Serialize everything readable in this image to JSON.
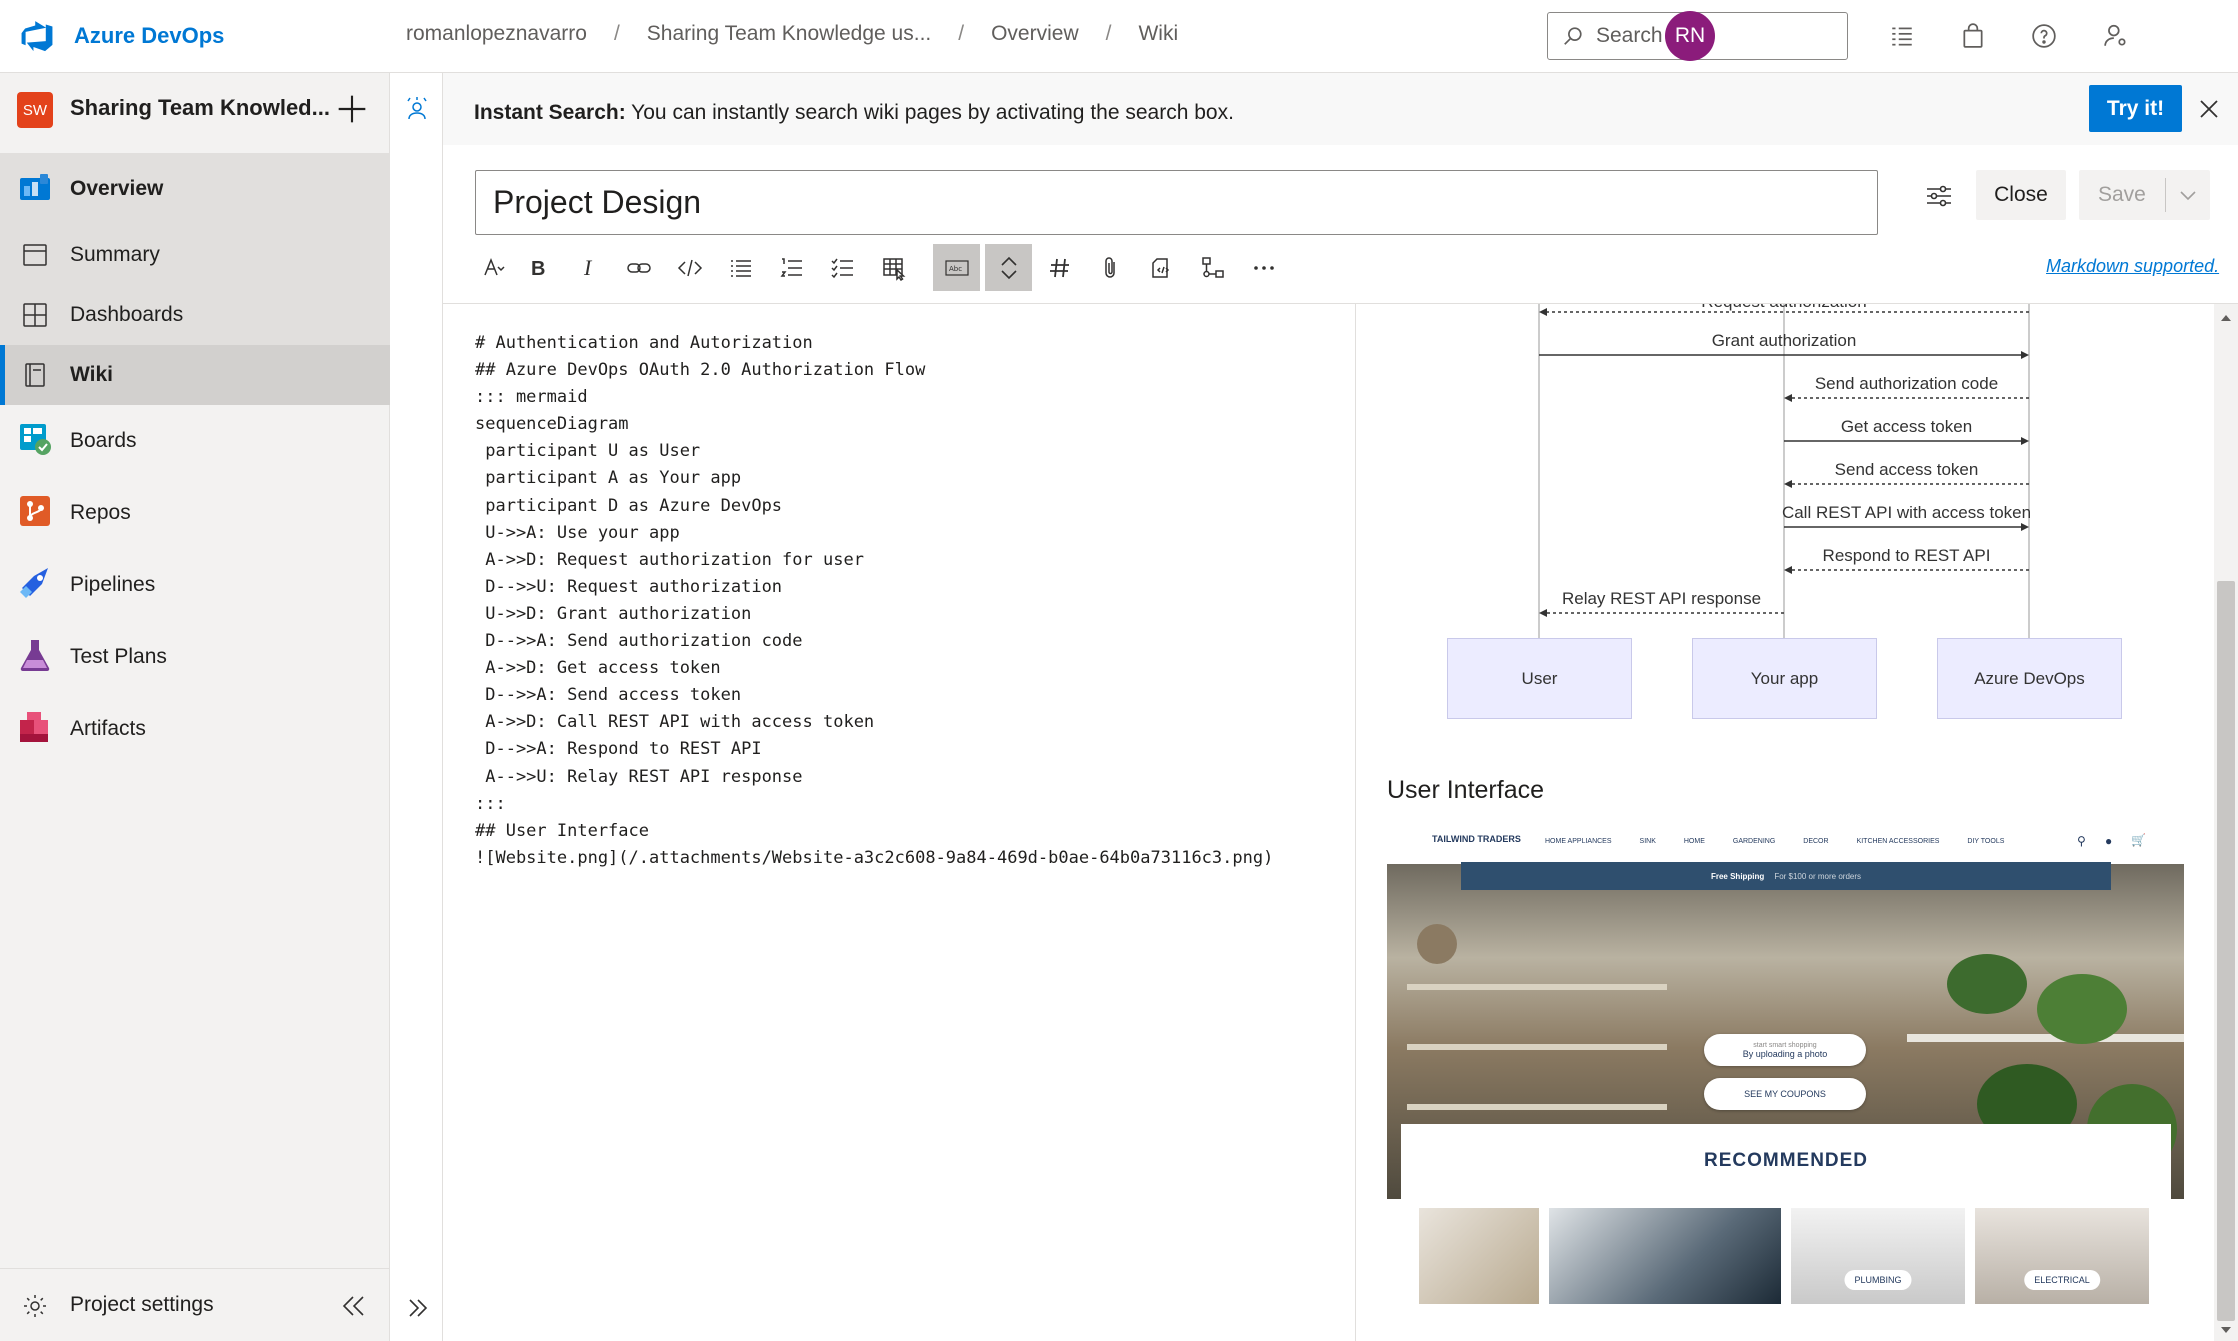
{
  "app": {
    "brand": "Azure DevOps",
    "breadcrumb": [
      "romanlopeznavarro",
      "Sharing Team Knowledge us...",
      "Overview",
      "Wiki"
    ],
    "search_placeholder": "Search",
    "avatar_initials": "RN",
    "brand_color": "#0078d4"
  },
  "sidebar": {
    "project_badge": "SW",
    "project_name": "Sharing Team Knowled...",
    "items": [
      {
        "label": "Overview",
        "icon": "overview-icon"
      },
      {
        "label": "Summary",
        "icon": "summary-icon"
      },
      {
        "label": "Dashboards",
        "icon": "dashboards-icon"
      },
      {
        "label": "Wiki",
        "icon": "wiki-icon"
      },
      {
        "label": "Boards",
        "icon": "boards-icon"
      },
      {
        "label": "Repos",
        "icon": "repos-icon"
      },
      {
        "label": "Pipelines",
        "icon": "pipelines-icon"
      },
      {
        "label": "Test Plans",
        "icon": "test-plans-icon"
      },
      {
        "label": "Artifacts",
        "icon": "artifacts-icon"
      }
    ],
    "footer_label": "Project settings"
  },
  "banner": {
    "bold": "Instant Search:",
    "text": " You can instantly search wiki pages by activating the search box.",
    "button": "Try it!"
  },
  "editor": {
    "title": "Project Design",
    "close_label": "Close",
    "save_label": "Save",
    "markdown_link": "Markdown supported.",
    "code": "# Authentication and Autorization\n## Azure DevOps OAuth 2.0 Authorization Flow\n::: mermaid\nsequenceDiagram\n participant U as User\n participant A as Your app\n participant D as Azure DevOps\n U->>A: Use your app\n A->>D: Request authorization for user\n D-->>U: Request authorization\n U->>D: Grant authorization\n D-->>A: Send authorization code\n A->>D: Get access token\n D-->>A: Send access token\n A->>D: Call REST API with access token\n D-->>A: Respond to REST API\n A-->>U: Relay REST API response\n:::\n## User Interface\n![Website.png](/.attachments/Website-a3c2c608-9a84-469d-b0ae-64b0a73116c3.png)"
  },
  "preview": {
    "partial_message": "Request authorization",
    "messages": [
      "Grant authorization",
      "Send authorization code",
      "Get access token",
      "Send access token",
      "Call REST API with access token",
      "Respond to REST API",
      "Relay REST API response"
    ],
    "actors": [
      "User",
      "Your app",
      "Azure DevOps"
    ],
    "section_heading": "User Interface",
    "website": {
      "logo": "TAILWIND TRADERS",
      "nav": [
        "HOME APPLIANCES",
        "SINK",
        "HOME",
        "GARDENING",
        "DECOR",
        "KITCHEN ACCESSORIES",
        "DIY TOOLS"
      ],
      "shipping": "Free Shipping",
      "shipping_note": "For $100 or more orders",
      "pill_small": "start smart shopping",
      "pill_main": "By uploading a photo",
      "coupons": "SEE MY COUPONS",
      "recommended": "RECOMMENDED",
      "tiles": [
        "PLUMBING",
        "ELECTRICAL"
      ]
    }
  }
}
